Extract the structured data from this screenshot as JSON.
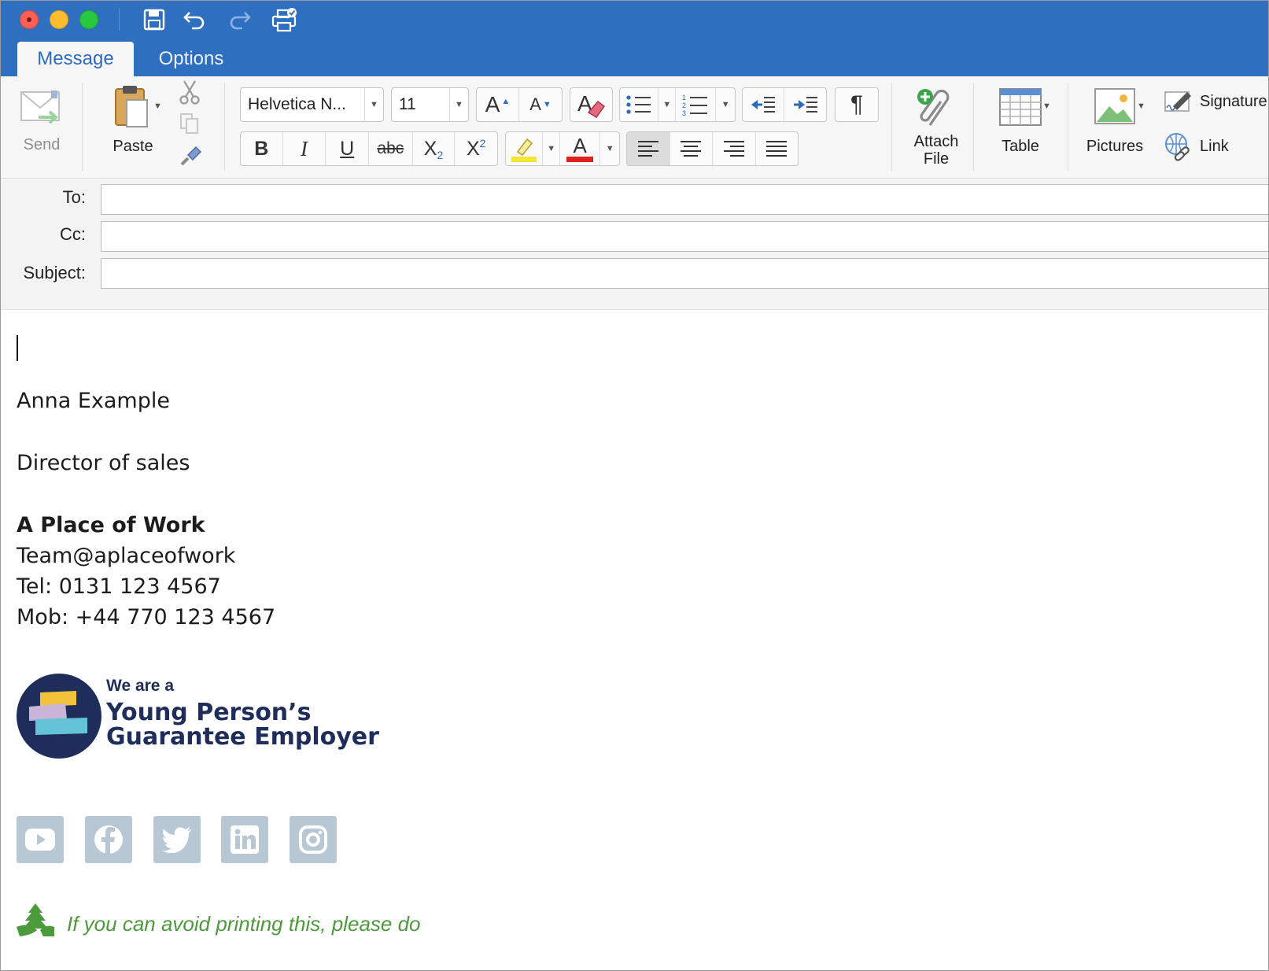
{
  "tabs": [
    {
      "label": "Message",
      "active": true
    },
    {
      "label": "Options",
      "active": false
    }
  ],
  "ribbon": {
    "send_label": "Send",
    "paste_label": "Paste",
    "font_name": "Helvetica N...",
    "font_size": "11",
    "bold": "B",
    "italic": "I",
    "underline": "U",
    "strikethrough": "abc",
    "subscript_base": "X",
    "subscript_mark": "2",
    "superscript_base": "X",
    "superscript_mark": "2",
    "grow_font": "A",
    "shrink_font": "A",
    "font_color_letter": "A",
    "pilcrow": "¶",
    "attach_label_1": "Attach",
    "attach_label_2": "File",
    "table_label": "Table",
    "pictures_label": "Pictures",
    "signature_label": "Signature",
    "link_label": "Link",
    "highlight_color": "#f5e535",
    "font_color": "#e02020"
  },
  "headers": {
    "to_label": "To:",
    "cc_label": "Cc:",
    "subject_label": "Subject:",
    "to_value": "",
    "cc_value": "",
    "subject_value": ""
  },
  "signature": {
    "name": "Anna Example",
    "title": "Director of sales",
    "company": "A Place of Work",
    "email": "Team@aplaceofwork",
    "tel": "Tel: 0131 123 4567",
    "mob": "Mob: +44 770 123 4567"
  },
  "badge": {
    "line1": "We are a",
    "line2": "Young Person’s",
    "line3": "Guarantee Employer"
  },
  "social_icons": [
    "youtube-icon",
    "facebook-icon",
    "twitter-icon",
    "linkedin-icon",
    "instagram-icon"
  ],
  "eco_message": "If you can avoid printing this, please do",
  "colors": {
    "titlebar": "#2f6fc0",
    "accent": "#2c6bc0",
    "badge_navy": "#1e2d5a",
    "social_grey": "#b7c7d4",
    "eco_green": "#4c9a3c"
  }
}
